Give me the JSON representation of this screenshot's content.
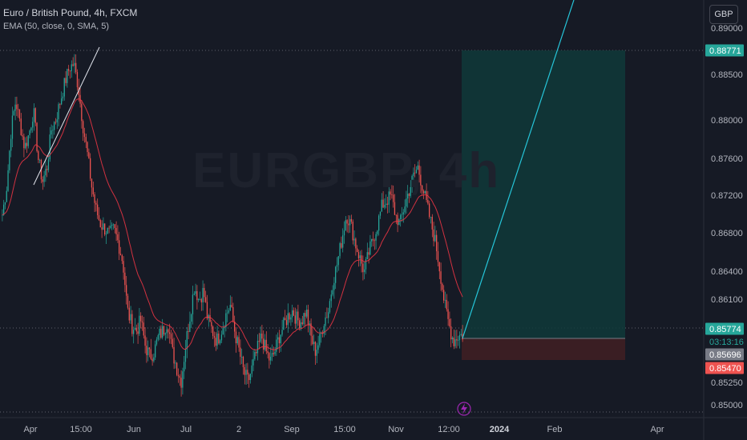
{
  "header": {
    "title": "Euro / British Pound, 4h, FXCM",
    "indicator": "EMA (50, close, 0, SMA, 5)",
    "currency_button": "GBP"
  },
  "watermark": {
    "symbol": "EURGBP, 4h",
    "subtitle": ""
  },
  "colors": {
    "background": "#161a25",
    "up_candle": "#26a69a",
    "down_candle": "#ef5350",
    "ema": "#f23645",
    "target_zone": "#0f3a3a",
    "stop_zone": "#3e1f24",
    "projection": "#26c6da",
    "trendline": "#e0e3eb"
  },
  "chart_data": {
    "type": "candlestick",
    "title": "Euro / British Pound, 4h, FXCM",
    "interval": "4h",
    "y_axis": {
      "ticks": [
        "0.89000",
        "0.88500",
        "0.88000",
        "0.87600",
        "0.87200",
        "0.86800",
        "0.86400",
        "0.86100",
        "0.85250",
        "0.85000"
      ],
      "range": [
        0.8485,
        0.8925
      ],
      "side": "right"
    },
    "x_axis": {
      "ticks": [
        {
          "label": "Apr",
          "bold": false
        },
        {
          "label": "15:00",
          "bold": false
        },
        {
          "label": "Jun",
          "bold": false
        },
        {
          "label": "Jul",
          "bold": false
        },
        {
          "label": "2",
          "bold": false
        },
        {
          "label": "Sep",
          "bold": false
        },
        {
          "label": "15:00",
          "bold": false
        },
        {
          "label": "Nov",
          "bold": false
        },
        {
          "label": "12:00",
          "bold": false
        },
        {
          "label": "2024",
          "bold": true
        },
        {
          "label": "Feb",
          "bold": false
        },
        {
          "label": "Apr",
          "bold": false
        }
      ]
    },
    "price_tags": [
      {
        "value": "0.88771",
        "role": "target",
        "color": "#26a69a"
      },
      {
        "value": "0.85774",
        "role": "current",
        "color": "#26a69a"
      },
      {
        "value": "03:13:16",
        "role": "countdown",
        "color": "#26a69a"
      },
      {
        "value": "0.85696",
        "role": "last",
        "color": "#787b86"
      },
      {
        "value": "0.85470",
        "role": "stop",
        "color": "#ef5350"
      }
    ],
    "position_tool": {
      "type": "long",
      "entry": 0.8575,
      "target": 0.88771,
      "stop": 0.8547
    },
    "price_path": [
      0.87,
      0.873,
      0.879,
      0.882,
      0.8795,
      0.877,
      0.8785,
      0.881,
      0.876,
      0.8735,
      0.875,
      0.879,
      0.88,
      0.882,
      0.884,
      0.8855,
      0.886,
      0.8835,
      0.8795,
      0.8765,
      0.873,
      0.8705,
      0.869,
      0.8685,
      0.868,
      0.8685,
      0.867,
      0.865,
      0.86,
      0.8585,
      0.858,
      0.859,
      0.8565,
      0.8555,
      0.856,
      0.8575,
      0.858,
      0.859,
      0.856,
      0.8545,
      0.853,
      0.8565,
      0.8595,
      0.8625,
      0.861,
      0.862,
      0.859,
      0.858,
      0.857,
      0.858,
      0.8595,
      0.8605,
      0.858,
      0.856,
      0.854,
      0.853,
      0.8545,
      0.856,
      0.8575,
      0.856,
      0.855,
      0.856,
      0.8575,
      0.8585,
      0.8595,
      0.86,
      0.859,
      0.859,
      0.86,
      0.8575,
      0.856,
      0.857,
      0.859,
      0.86,
      0.863,
      0.865,
      0.8675,
      0.87,
      0.869,
      0.867,
      0.8655,
      0.864,
      0.866,
      0.8675,
      0.869,
      0.871,
      0.8715,
      0.872,
      0.87,
      0.869,
      0.871,
      0.8725,
      0.874,
      0.875,
      0.873,
      0.871,
      0.869,
      0.867,
      0.864,
      0.8605,
      0.8585,
      0.857,
      0.8575,
      0.8576
    ]
  }
}
